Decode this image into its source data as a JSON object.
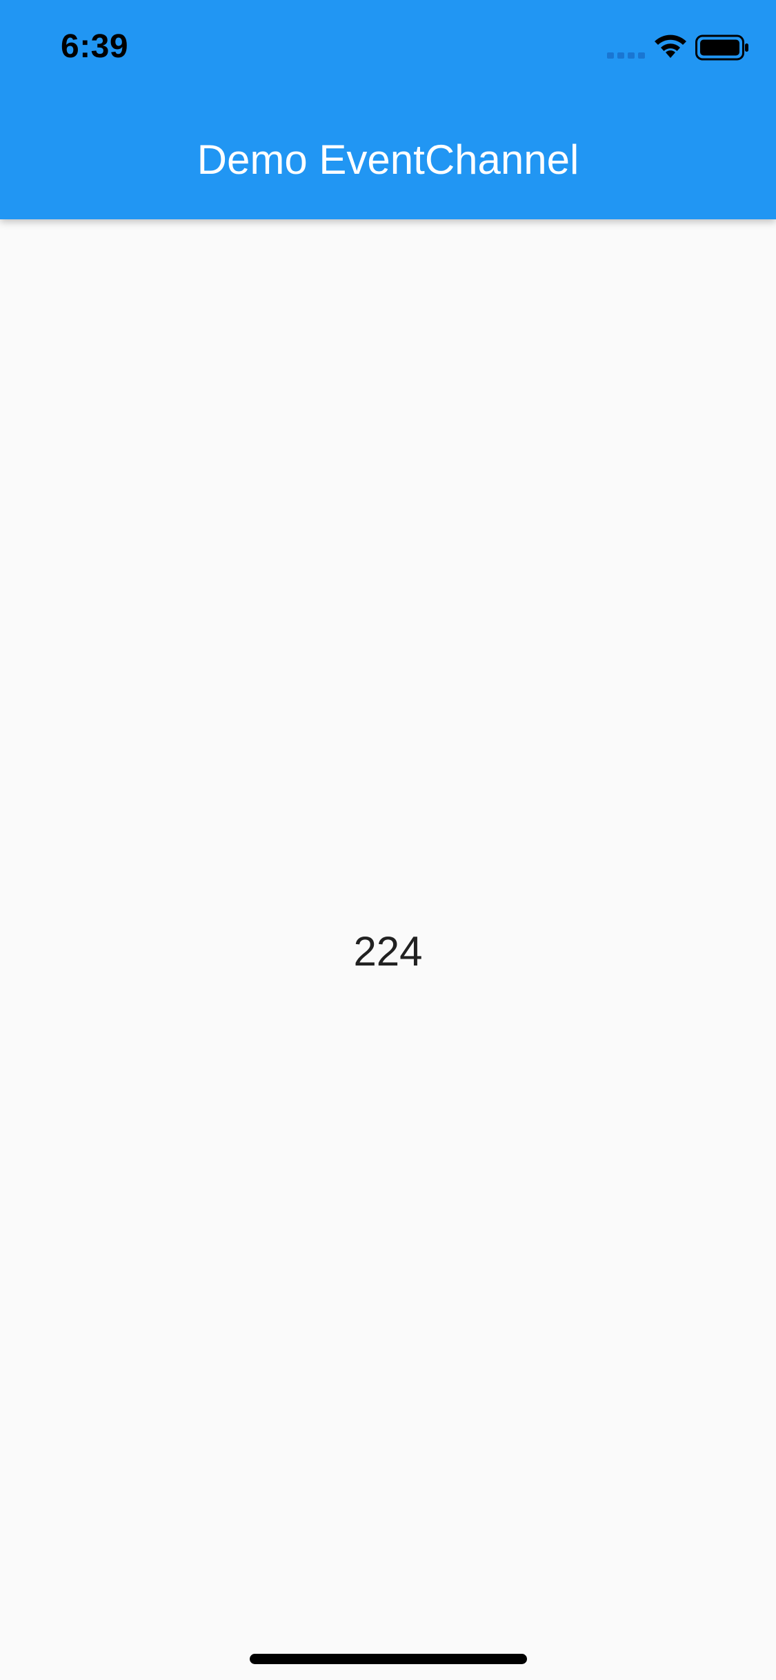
{
  "status_bar": {
    "time": "6:39"
  },
  "app_bar": {
    "title": "Demo EventChannel",
    "color": "#2196F3"
  },
  "main": {
    "counter_value": "224"
  },
  "icons": {
    "signal": "cellular-signal-icon",
    "wifi": "wifi-icon",
    "battery": "battery-icon"
  }
}
